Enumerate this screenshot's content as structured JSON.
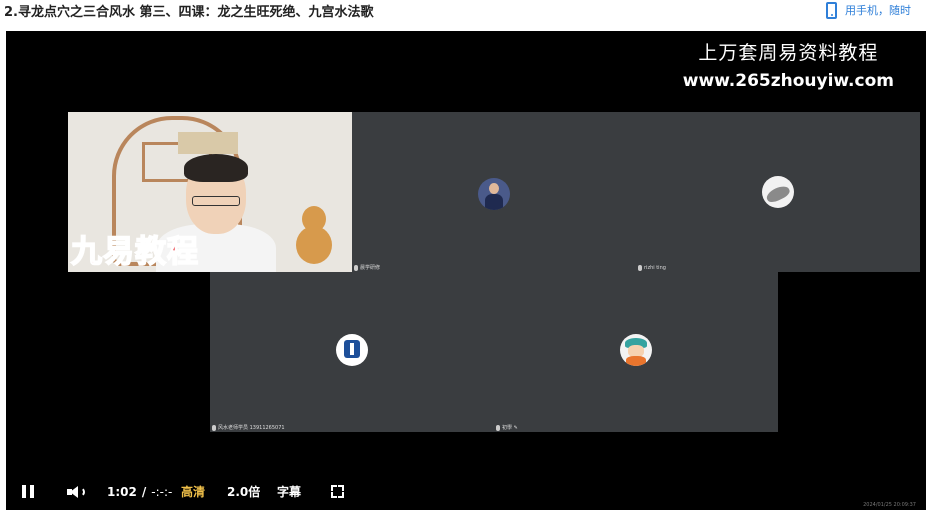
{
  "page": {
    "title": "2.寻龙点穴之三合风水 第三、四课：龙之生旺死绝、九宫水法歌"
  },
  "mobile": {
    "icon": "mobile-phone-icon",
    "text": "用手机，随时"
  },
  "watermark": {
    "line1": "上万套周易资料教程",
    "line2": "www.265zhouyiw.com"
  },
  "presenter": {
    "brand_text": "九易教程"
  },
  "tiles": [
    {
      "label": "晨学研修",
      "avatar": "person-avatar"
    },
    {
      "label": "rizhi ting",
      "avatar": "shell-avatar"
    },
    {
      "label": "风水老师学员 13911265071",
      "avatar": "logo-avatar"
    },
    {
      "label": "初學 ✎",
      "avatar": "cartoon-avatar"
    }
  ],
  "controls": {
    "current_time": "1:02",
    "separator": "/",
    "duration": "-:-:-",
    "quality": "高清",
    "speed": "2.0倍",
    "subtitles": "字幕"
  },
  "timestamp": "2024/01/25 20:09:37",
  "colors": {
    "accent": "#2f7fd8",
    "quality": "#f0c04a",
    "brand_red": "#e8202a",
    "tile_bg": "#3a3d40"
  }
}
